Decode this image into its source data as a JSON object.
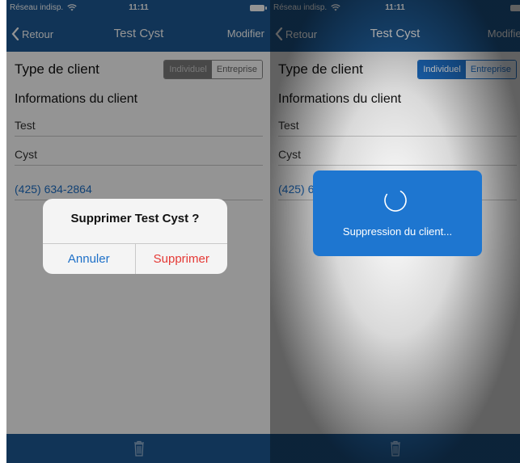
{
  "status": {
    "carrier": "Réseau indisp.",
    "time": "11:11"
  },
  "nav": {
    "back_label": "Retour",
    "title": "Test Cyst",
    "edit_label": "Modifier"
  },
  "form": {
    "type_label": "Type de client",
    "segments": [
      "Individuel",
      "Entreprise"
    ],
    "section_title": "Informations du client",
    "first_name": "Test",
    "last_name": "Cyst",
    "phone": "(425) 634-2864"
  },
  "alert": {
    "title": "Supprimer Test Cyst ?",
    "cancel_label": "Annuler",
    "delete_label": "Supprimer"
  },
  "loader": {
    "text": "Suppression du client..."
  },
  "icons": {
    "back": "chevron-left-icon",
    "wifi": "wifi-icon",
    "battery": "battery-icon",
    "trash": "trash-icon",
    "spinner": "spinner-icon"
  },
  "colors": {
    "nav_bg": "#1e5b96",
    "accent": "#1e70c8",
    "danger": "#e53935",
    "loader_bg": "#1e76d0"
  }
}
